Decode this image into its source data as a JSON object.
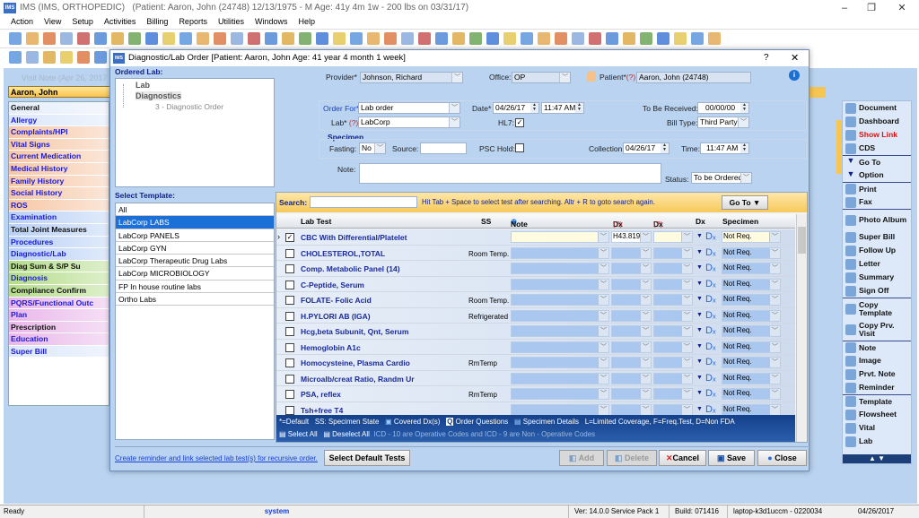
{
  "app": {
    "title": "IMS (IMS, ORTHOPEDIC)",
    "patient_banner": "(Patient: Aaron, John  (24748) 12/13/1975 - M Age: 41y 4m 1w - 200 lbs on 03/31/17)",
    "logo": "IMS"
  },
  "menu": [
    "Action",
    "View",
    "Setup",
    "Activities",
    "Billing",
    "Reports",
    "Utilities",
    "Windows",
    "Help"
  ],
  "visit_note": {
    "title": "Visit Note (Apr 26, 2017",
    "patient": "Aaron, John"
  },
  "left_nav": [
    {
      "label": "General",
      "bg": "#e6eefa",
      "color": "#111"
    },
    {
      "label": "Allergy",
      "bg": "#dbe7fa",
      "color": "#1a1adc"
    },
    {
      "label": "Complaints/HPI",
      "bg": "#f6c7a6",
      "color": "#1a1adc"
    },
    {
      "label": "Vital Signs",
      "bg": "#f6c7a6",
      "color": "#1a1adc"
    },
    {
      "label": "Current Medication",
      "bg": "#f6c7a6",
      "color": "#1a1adc"
    },
    {
      "label": "Medical History",
      "bg": "#f6c7a6",
      "color": "#1a1adc"
    },
    {
      "label": "Family History",
      "bg": "#f6c7a6",
      "color": "#1a1adc"
    },
    {
      "label": "Social History",
      "bg": "#f6c7a6",
      "color": "#1a1adc"
    },
    {
      "label": "ROS",
      "bg": "#f6c7a6",
      "color": "#1a1adc"
    },
    {
      "label": "Examination",
      "bg": "#b9d0f5",
      "color": "#1a1adc"
    },
    {
      "label": "Total Joint Measures",
      "bg": "#b9d0f5",
      "color": "#111"
    },
    {
      "label": "Procedures",
      "bg": "#b9d0f5",
      "color": "#1a1adc"
    },
    {
      "label": "Diagnostic/Lab",
      "bg": "#b9d0f5",
      "color": "#1a1adc"
    },
    {
      "label": "Diag Sum & S/P Su",
      "bg": "#b4dc8a",
      "color": "#111"
    },
    {
      "label": "Diagnosis",
      "bg": "#b4dc8a",
      "color": "#1a1adc"
    },
    {
      "label": "Compliance Confirm",
      "bg": "#b4dc8a",
      "color": "#111"
    },
    {
      "label": "PQRS/Functional Outc",
      "bg": "#e9b7ea",
      "color": "#1a1adc"
    },
    {
      "label": "Plan",
      "bg": "#e9b7ea",
      "color": "#1a1adc"
    },
    {
      "label": "Prescription",
      "bg": "#e9b7ea",
      "color": "#111"
    },
    {
      "label": "Education",
      "bg": "#e9b7ea",
      "color": "#1a1adc"
    },
    {
      "label": "Super Bill",
      "bg": "#dbe7fa",
      "color": "#1a1adc"
    }
  ],
  "right_panel": [
    {
      "label": "Document",
      "icon": "document-icon",
      "color": "#111",
      "sep": false
    },
    {
      "label": "Dashboard",
      "icon": "dashboard-icon",
      "color": "#111",
      "sep": false
    },
    {
      "label": "Show Link",
      "icon": "link-icon",
      "color": "#e01010",
      "sep": false
    },
    {
      "label": "CDS",
      "icon": "cds-icon",
      "color": "#111",
      "sep": false
    },
    {
      "label": "Go To",
      "icon": "triangle-down-icon",
      "color": "#111",
      "sep": true
    },
    {
      "label": "Option",
      "icon": "triangle-down-icon",
      "color": "#111",
      "sep": false
    },
    {
      "label": "Print",
      "icon": "printer-icon",
      "color": "#111",
      "sep": true
    },
    {
      "label": "Fax",
      "icon": "fax-icon",
      "color": "#111",
      "sep": false
    },
    {
      "label": "Photo Album",
      "icon": "photo-album-icon",
      "color": "#111",
      "sep": true
    },
    {
      "label": "Super Bill",
      "icon": "dollar-icon",
      "color": "#111",
      "sep": false
    },
    {
      "label": "Follow Up",
      "icon": "calendar-icon",
      "color": "#111",
      "sep": false
    },
    {
      "label": "Letter",
      "icon": "pencil-icon",
      "color": "#111",
      "sep": false
    },
    {
      "label": "Summary",
      "icon": "summary-icon",
      "color": "#111",
      "sep": false
    },
    {
      "label": "Sign Off",
      "icon": "user-sign-off-icon",
      "color": "#111",
      "sep": false
    },
    {
      "label": "Copy Template",
      "icon": "copy-icon",
      "color": "#111",
      "sep": true
    },
    {
      "label": "Copy Prv. Visit",
      "icon": "copy-icon",
      "color": "#111",
      "sep": false
    },
    {
      "label": "Note",
      "icon": "note-icon",
      "color": "#111",
      "sep": true
    },
    {
      "label": "Image",
      "icon": "image-icon",
      "color": "#111",
      "sep": false
    },
    {
      "label": "Prvt. Note",
      "icon": "private-note-icon",
      "color": "#111",
      "sep": false
    },
    {
      "label": "Reminder",
      "icon": "reminder-icon",
      "color": "#111",
      "sep": false
    },
    {
      "label": "Template",
      "icon": "checklist-icon",
      "color": "#111",
      "sep": true
    },
    {
      "label": "Flowsheet",
      "icon": "checklist-icon",
      "color": "#111",
      "sep": false
    },
    {
      "label": "Vital",
      "icon": "checklist-icon",
      "color": "#111",
      "sep": false
    },
    {
      "label": "Lab",
      "icon": "checklist-icon",
      "color": "#111",
      "sep": false
    }
  ],
  "dialog": {
    "title": "Diagnostic/Lab Order  [Patient: Aaron, John   Age: 41 year 4 month 1 week]",
    "help": "?",
    "close": "✕",
    "ordered_lab": {
      "label": "Ordered Lab:",
      "tree": [
        "Lab",
        "Diagnostics",
        "3 - Diagnostic Order"
      ]
    },
    "form": {
      "provider_label": "Provider*",
      "provider": "Johnson, Richard",
      "office_label": "Office:",
      "office": "OP",
      "patient_label": "Patient*",
      "patient_help": "(?)",
      "patient": "Aaron, John  (24748)",
      "order_for_label": "Order For*",
      "order_for": "Lab order",
      "date_label": "Date*",
      "date": "04/26/17",
      "time": "11:47 AM",
      "to_be_received_label": "To Be Received:",
      "to_be_received": "00/00/00",
      "lab_label": "Lab*",
      "lab_help": "(?)",
      "lab": "LabCorp",
      "hl7_label": "HL7:",
      "hl7_checked": true,
      "bill_type_label": "Bill Type:",
      "bill_type": "Third Party",
      "specimen_label": "Specimen",
      "fasting_label": "Fasting:",
      "fasting": "No",
      "source_label": "Source:",
      "source": "",
      "psc_hold_label": "PSC Hold:",
      "psc_hold_checked": false,
      "collection_label": "Collection:",
      "collection": "04/26/17",
      "time_label": "Time:",
      "collection_time": "11:47 AM",
      "note_label": "Note:",
      "note": "",
      "status_label": "Status:",
      "status": "To be Ordered"
    },
    "select_template": {
      "label": "Select Template:",
      "items": [
        "All",
        "LabCorp LABS",
        "LabCorp PANELS",
        "LabCorp GYN",
        "LabCorp Therapeutic Drug Labs",
        "LabCorp MICROBIOLOGY",
        "FP In house routine labs",
        "Ortho Labs"
      ],
      "selected": 1
    },
    "grid": {
      "search_label": "Search:",
      "search_value": "",
      "search_hint": "Hit Tab + Space to select test after searching. Altr + R to goto search again.",
      "goto_label": "Go To",
      "columns": {
        "lab_test": "Lab Test",
        "ss": "SS",
        "note": "Note",
        "dx1": "Dx (1)",
        "dx1_help": "(?)",
        "dx2": "Dx (2)",
        "dx2_help": "(?)",
        "dx": "Dx",
        "specimen": "Specimen"
      },
      "rows": [
        {
          "name": "CBC With Differential/Platelet",
          "ss": "",
          "checked": true,
          "dx1": "H43.819",
          "specimen": "Not Req.",
          "current": true
        },
        {
          "name": "CHOLESTEROL,TOTAL",
          "ss": "Room Temp.",
          "checked": false,
          "dx1": "",
          "specimen": "Not Req."
        },
        {
          "name": "Comp. Metabolic Panel (14)",
          "ss": "",
          "checked": false,
          "dx1": "",
          "specimen": "Not Req."
        },
        {
          "name": "C-Peptide, Serum",
          "ss": "",
          "checked": false,
          "dx1": "",
          "specimen": "Not Req."
        },
        {
          "name": "FOLATE- Folic Acid",
          "ss": "Room Temp.",
          "checked": false,
          "dx1": "",
          "specimen": "Not Req."
        },
        {
          "name": "H.PYLORI AB (IGA)",
          "ss": "Refrigerated",
          "checked": false,
          "dx1": "",
          "specimen": "Not Req."
        },
        {
          "name": "Hcg,beta Subunit, Qnt, Serum",
          "ss": "",
          "checked": false,
          "dx1": "",
          "specimen": "Not Req."
        },
        {
          "name": "Hemoglobin A1c",
          "ss": "",
          "checked": false,
          "dx1": "",
          "specimen": "Not Req."
        },
        {
          "name": "Homocysteine, Plasma Cardio",
          "ss": "RmTemp",
          "checked": false,
          "dx1": "",
          "specimen": "Not Req."
        },
        {
          "name": "Microalb/creat Ratio, Randm Ur",
          "ss": "",
          "checked": false,
          "dx1": "",
          "specimen": "Not Req."
        },
        {
          "name": "PSA, reflex",
          "ss": "RmTemp",
          "checked": false,
          "dx1": "",
          "specimen": "Not Req."
        },
        {
          "name": "Tsh+free T4",
          "ss": "",
          "checked": false,
          "dx1": "",
          "specimen": "Not Req."
        }
      ],
      "legend": {
        "default": "*=Default",
        "ss": "SS: Specimen State",
        "covered": "Covered Dx(s)",
        "questions": "Order Questions",
        "specimen_details": "Specimen Details",
        "coverage": "L=Limited Coverage, F=Freq.Test, D=Non FDA",
        "select_all": "Select All",
        "deselect_all": "Deselect All",
        "icd_note": "ICD - 10 are Operative Codes and ICD - 9 are Non - Operative Codes"
      }
    },
    "footer": {
      "recursive_link": "Create reminder and link selected lab test(s) for recursive order.",
      "select_default": "Select Default Tests",
      "add": "Add",
      "delete": "Delete",
      "cancel": "Cancel",
      "save": "Save",
      "close": "Close"
    }
  },
  "status_bar": {
    "ready": "Ready",
    "user": "system",
    "version": "Ver: 14.0.0 Service Pack 1",
    "build": "Build: 071416",
    "machine": "laptop-k3d1uccm - 0220034",
    "date": "04/26/2017"
  }
}
